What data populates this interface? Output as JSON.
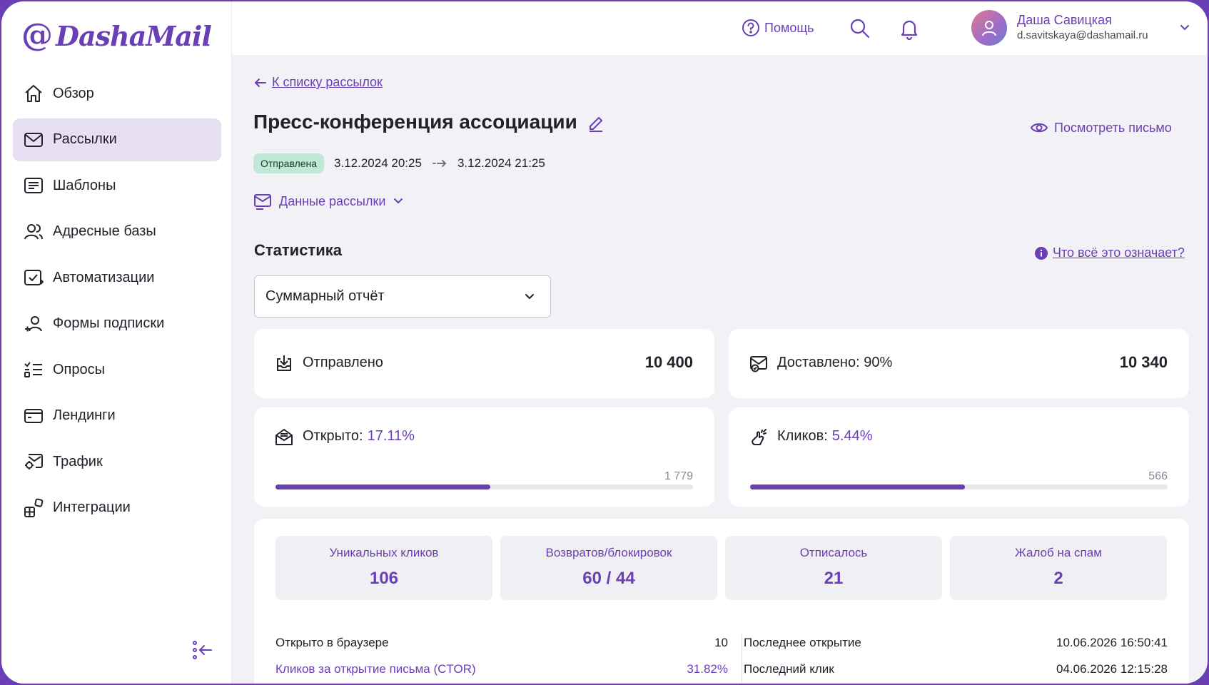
{
  "brand": {
    "at": "@",
    "name": "DashaMail"
  },
  "sidebar": {
    "items": [
      {
        "label": "Обзор",
        "icon": "home-icon",
        "active": false
      },
      {
        "label": "Рассылки",
        "icon": "mail-icon",
        "active": true
      },
      {
        "label": "Шаблоны",
        "icon": "template-icon",
        "active": false
      },
      {
        "label": "Адресные базы",
        "icon": "contacts-icon",
        "active": false
      },
      {
        "label": "Автоматизации",
        "icon": "automation-icon",
        "active": false
      },
      {
        "label": "Формы подписки",
        "icon": "add-user-icon",
        "active": false
      },
      {
        "label": "Опросы",
        "icon": "checklist-icon",
        "active": false
      },
      {
        "label": "Лендинги",
        "icon": "browser-icon",
        "active": false
      },
      {
        "label": "Трафик",
        "icon": "traffic-icon",
        "active": false
      },
      {
        "label": "Интеграции",
        "icon": "integrations-icon",
        "active": false
      }
    ]
  },
  "header": {
    "help_label": "Помощь",
    "user": {
      "name": "Даша Савицкая",
      "email": "d.savitskaya@dashamail.ru"
    }
  },
  "main": {
    "back_label": "К списку рассылок",
    "title": "Пресс-конференция ассоциации",
    "view_letter_label": "Посмотреть письмо",
    "status": {
      "badge": "Отправлена",
      "start": "3.12.2024 20:25",
      "end": "3.12.2024 21:25"
    },
    "mail_data_label": "Данные рассылки",
    "stats_title": "Статистика",
    "what_label": "Что всё это означает?",
    "report_select": "Суммарный отчёт",
    "cards": {
      "sent": {
        "label": "Отправлено",
        "value": "10 400"
      },
      "delivered": {
        "label": "Доставлено: 90%",
        "value": "10 340"
      },
      "opened": {
        "label": "Открыто:",
        "pct": "17.11%",
        "count": "1 779",
        "progress": 0.515
      },
      "clicks": {
        "label": "Кликов:",
        "pct": "5.44%",
        "count": "566",
        "progress": 0.515
      }
    },
    "tiles": [
      {
        "label": "Уникальных кликов",
        "value": "106"
      },
      {
        "label": "Возвратов/блокировок",
        "value": "60 / 44"
      },
      {
        "label": "Отписалось",
        "value": "21"
      },
      {
        "label": "Жалоб на спам",
        "value": "2"
      }
    ],
    "details": {
      "browser_label": "Открыто в браузере",
      "browser_value": "10",
      "ctor_label": "Кликов за открытие письма (CTOR)",
      "ctor_value": "31.82%",
      "last_open_label": "Последнее открытие",
      "last_open_value": "10.06.2026 16:50:41",
      "last_click_label": "Последний клик",
      "last_click_value": "04.06.2026 12:15:28"
    }
  },
  "colors": {
    "accent": "#6a3fb5",
    "active_bg": "#e7e0f2",
    "badge_bg": "#bfe9d6"
  }
}
